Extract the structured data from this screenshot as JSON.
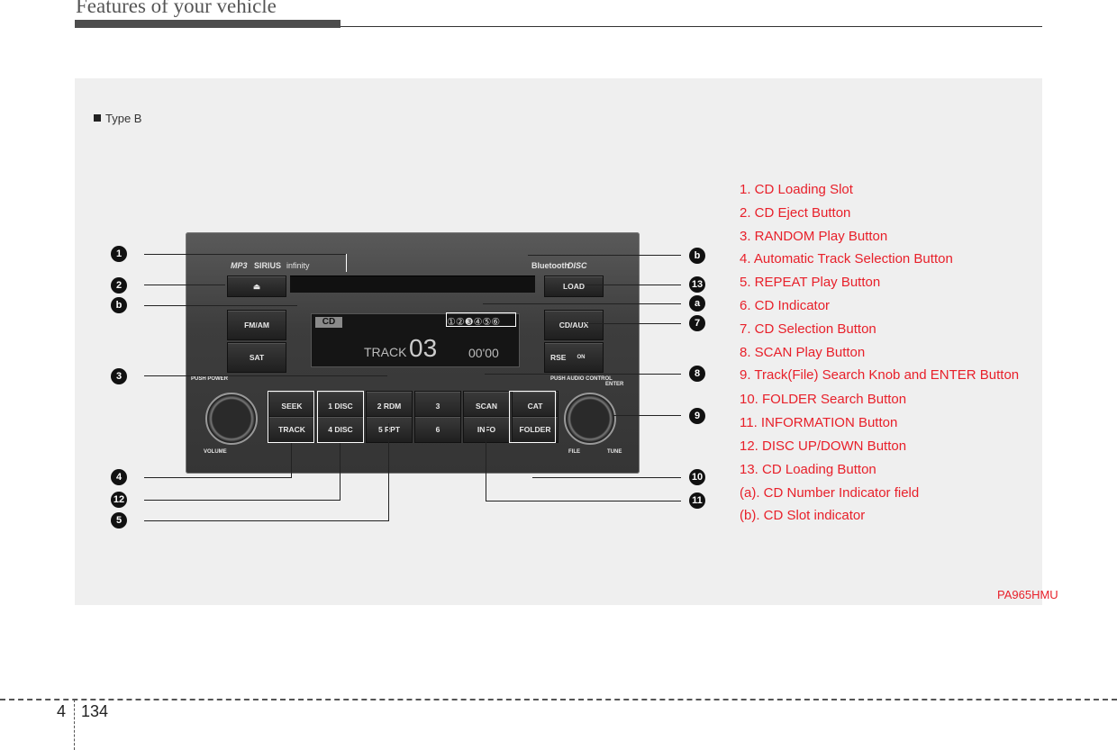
{
  "header": {
    "title": "Features of your vehicle"
  },
  "figure": {
    "type_label": "Type B",
    "code": "PA965HMU",
    "radio": {
      "brand_logos": [
        "MP3",
        "SIRIUS",
        "infinity"
      ],
      "right_logos": [
        "Bluetooth",
        "DISC"
      ],
      "eject_symbol": "⏏",
      "load": "LOAD",
      "fm_am": "FM/AM",
      "sat": "SAT",
      "cd_aux": "CD/AUX",
      "rse": "RSE",
      "rse_on": "ON",
      "display": {
        "mode": "CD",
        "discs": "①②❸④⑤⑥",
        "track_label": "TRACK",
        "track_num": "03",
        "time": "00'00"
      },
      "push_power": "PUSH POWER",
      "volume": "VOLUME",
      "push_audio_control": "PUSH AUDIO CONTROL",
      "enter": "ENTER",
      "file": "FILE",
      "tune": "TUNE",
      "buttons_top": [
        "SEEK",
        "1  DISC",
        "2  RDM",
        "3",
        "SCAN",
        "CAT"
      ],
      "buttons_bottom": [
        "TRACK",
        "4  DISC",
        "5  RPT",
        "6",
        "INFO",
        "FOLDER"
      ]
    },
    "callouts_left": [
      "1",
      "2",
      "b",
      "3",
      "4",
      "12",
      "5"
    ],
    "callouts_right": [
      "b",
      "13",
      "a",
      "7",
      "8",
      "9",
      "10",
      "11"
    ],
    "legend": [
      "1. CD Loading Slot",
      "2. CD Eject Button",
      "3. RANDOM Play Button",
      "4. Automatic Track Selection Button",
      "5. REPEAT Play Button",
      "6. CD Indicator",
      "7. CD Selection Button",
      "8. SCAN Play Button",
      "9. Track(File) Search Knob and ENTER Button",
      "10. FOLDER Search Button",
      "11. INFORMATION Button",
      "12. DISC UP/DOWN Button",
      "13. CD Loading Button",
      "(a). CD Number Indicator field",
      "(b). CD Slot indicator"
    ]
  },
  "footer": {
    "section": "4",
    "page": "134"
  }
}
